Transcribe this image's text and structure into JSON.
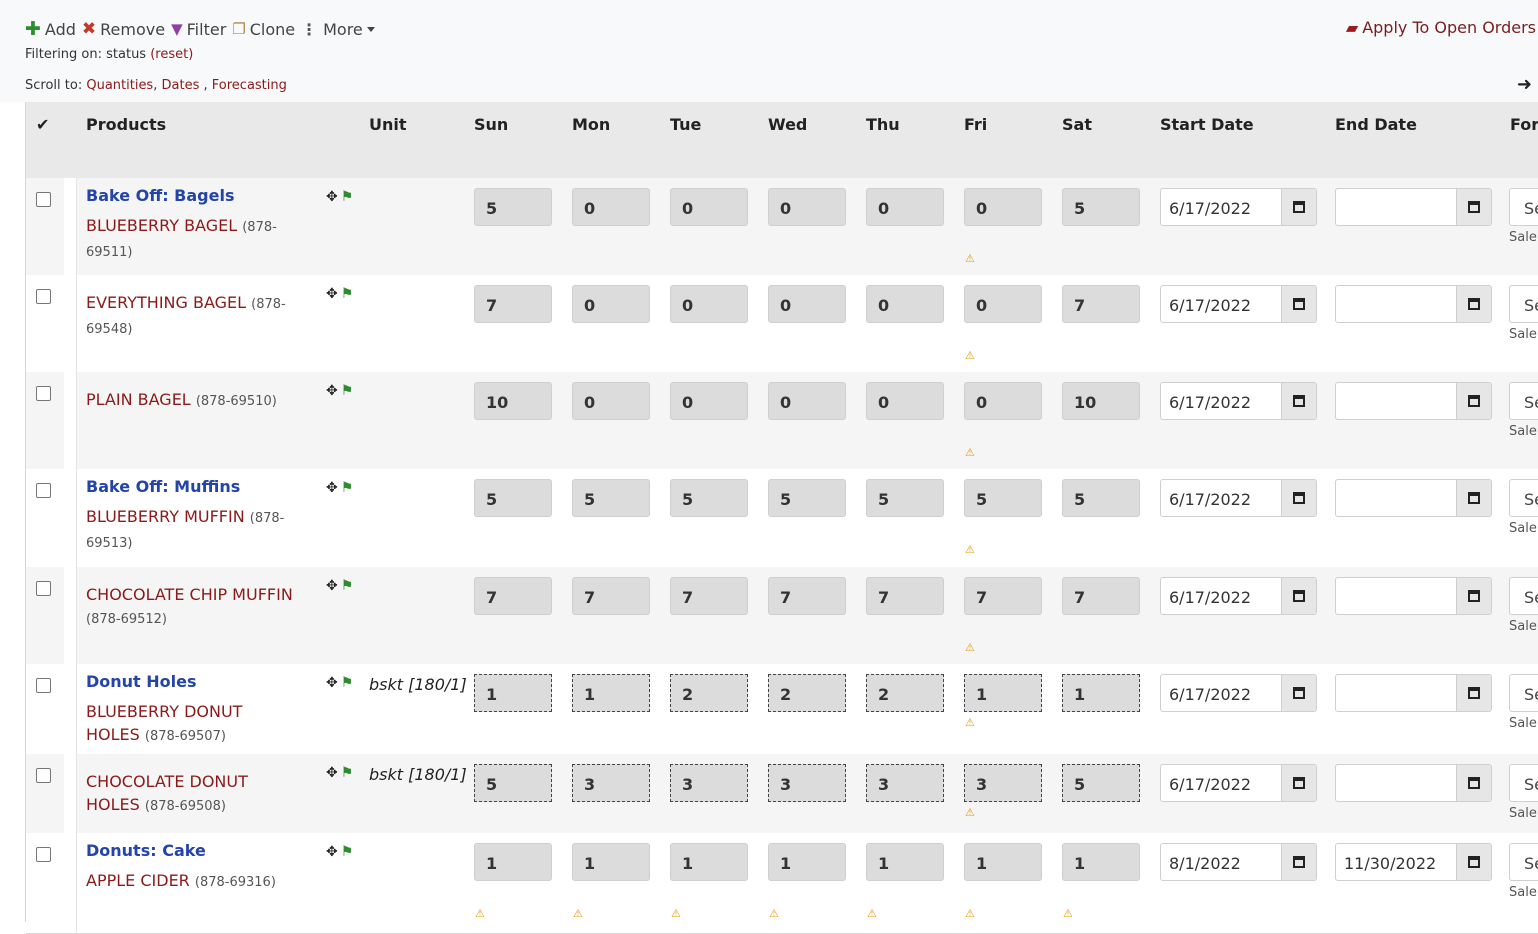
{
  "toolbar": {
    "add_label": "Add",
    "remove_label": "Remove",
    "filter_label": "Filter",
    "clone_label": "Clone",
    "more_label": "More",
    "apply_label": "Apply To Open Orders"
  },
  "filtering": {
    "prefix": "Filtering on: status",
    "reset_label": "(reset)"
  },
  "scrollto": {
    "prefix": "Scroll to:",
    "quantities": "Quantities",
    "dates": "Dates",
    "forecasting": "Forecasting",
    "sep1": ",",
    "sep2": " ,"
  },
  "header": {
    "check": "✔",
    "products": "Products",
    "unit": "Unit",
    "days": [
      "Sun",
      "Mon",
      "Tue",
      "Wed",
      "Thu",
      "Fri",
      "Sat"
    ],
    "start_date": "Start Date",
    "end_date": "End Date",
    "forecasting": "Fore"
  },
  "forecast_partial": "Se",
  "forecast_sub": "Sale",
  "rows": [
    {
      "group": "Bake Off: Bagels",
      "name": "BLUEBERRY BAGEL",
      "code": "(878-69511)",
      "unit": "",
      "qty": [
        "5",
        "0",
        "0",
        "0",
        "0",
        "0",
        "5"
      ],
      "start": "6/17/2022",
      "end": ""
    },
    {
      "group": "",
      "name": "EVERYTHING BAGEL",
      "code": "(878-69548)",
      "unit": "",
      "qty": [
        "7",
        "0",
        "0",
        "0",
        "0",
        "0",
        "7"
      ],
      "start": "6/17/2022",
      "end": ""
    },
    {
      "group": "",
      "name": "PLAIN BAGEL",
      "code": "(878-69510)",
      "unit": "",
      "qty": [
        "10",
        "0",
        "0",
        "0",
        "0",
        "0",
        "10"
      ],
      "start": "6/17/2022",
      "end": ""
    },
    {
      "group": "Bake Off: Muffins",
      "name": "BLUEBERRY MUFFIN",
      "code": "(878-69513)",
      "unit": "",
      "qty": [
        "5",
        "5",
        "5",
        "5",
        "5",
        "5",
        "5"
      ],
      "start": "6/17/2022",
      "end": ""
    },
    {
      "group": "",
      "name": "CHOCOLATE CHIP MUFFIN",
      "code": "(878-69512)",
      "unit": "",
      "qty": [
        "7",
        "7",
        "7",
        "7",
        "7",
        "7",
        "7"
      ],
      "start": "6/17/2022",
      "end": ""
    },
    {
      "group": "Donut Holes",
      "name": "BLUEBERRY DONUT HOLES",
      "code": "(878-69507)",
      "unit": "bskt [180/1]",
      "qty": [
        "1",
        "1",
        "2",
        "2",
        "2",
        "1",
        "1"
      ],
      "start": "6/17/2022",
      "end": ""
    },
    {
      "group": "",
      "name": "CHOCOLATE DONUT HOLES",
      "code": "(878-69508)",
      "unit": "bskt [180/1]",
      "qty": [
        "5",
        "3",
        "3",
        "3",
        "3",
        "3",
        "5"
      ],
      "start": "6/17/2022",
      "end": ""
    },
    {
      "group": "Donuts: Cake",
      "name": "APPLE CIDER",
      "code": "(878-69316)",
      "unit": "",
      "qty": [
        "1",
        "1",
        "1",
        "1",
        "1",
        "1",
        "1"
      ],
      "start": "8/1/2022",
      "end": "11/30/2022"
    }
  ]
}
